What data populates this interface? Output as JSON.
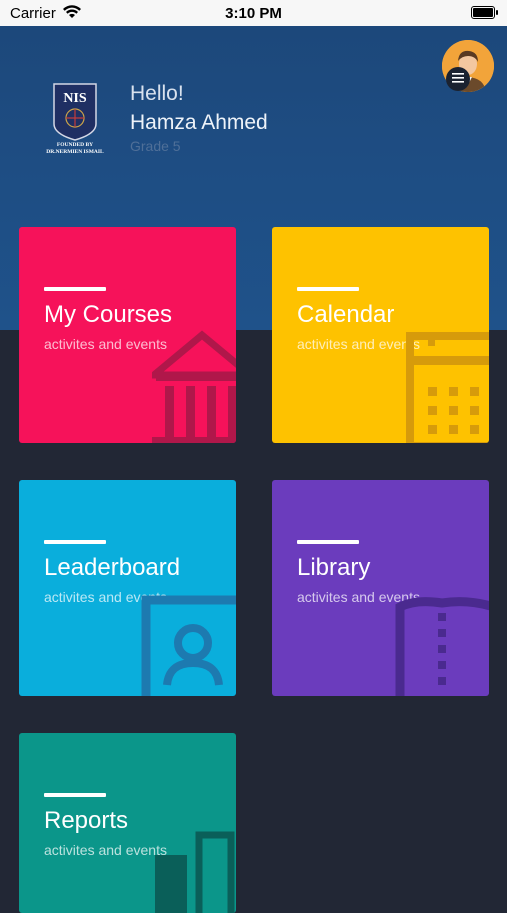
{
  "status": {
    "carrier": "Carrier",
    "time": "3:10 PM"
  },
  "header": {
    "greeting": "Hello!",
    "user_name": "Hamza Ahmed",
    "grade": "Grade 5",
    "logo": {
      "name": "NIS",
      "founded_line1": "FOUNDED BY",
      "founded_line2": "DR.NERMIEN ISMAIL"
    }
  },
  "tiles": [
    {
      "title": "My Courses",
      "subtitle": "activites and events",
      "color": "#f6125a",
      "icon": "building-icon"
    },
    {
      "title": "Calendar",
      "subtitle": "activites and events",
      "color": "#fec200",
      "icon": "calendar-icon"
    },
    {
      "title": "Leaderboard",
      "subtitle": "activites and events",
      "color": "#0aaedc",
      "icon": "person-card-icon"
    },
    {
      "title": "Library",
      "subtitle": "activites and events",
      "color": "#6b3cbd",
      "icon": "book-icon"
    },
    {
      "title": "Reports",
      "subtitle": "activites and events",
      "color": "#0b968a",
      "icon": "bar-chart-icon"
    }
  ]
}
